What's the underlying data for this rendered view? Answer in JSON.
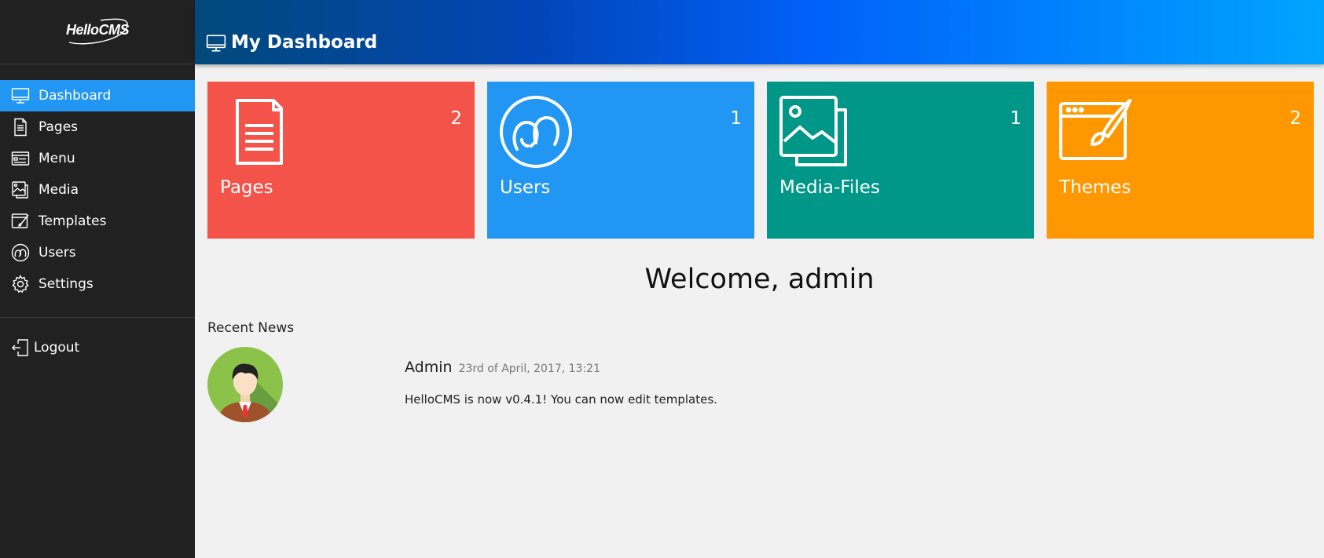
{
  "sidebar": {
    "logo": "HelloCMS",
    "items": [
      {
        "label": "Dashboard",
        "icon": "monitor-icon",
        "active": true
      },
      {
        "label": "Pages",
        "icon": "page-icon"
      },
      {
        "label": "Menu",
        "icon": "menu-icon"
      },
      {
        "label": "Media",
        "icon": "media-icon"
      },
      {
        "label": "Templates",
        "icon": "template-icon"
      },
      {
        "label": "Users",
        "icon": "users-icon"
      },
      {
        "label": "Settings",
        "icon": "gear-icon"
      }
    ],
    "logout": "Logout"
  },
  "header": {
    "title": "My Dashboard"
  },
  "tiles": [
    {
      "label": "Pages",
      "count": "2",
      "color": "#f4534a",
      "icon": "page-icon"
    },
    {
      "label": "Users",
      "count": "1",
      "color": "#2196f3",
      "icon": "users-icon"
    },
    {
      "label": "Media-Files",
      "count": "1",
      "color": "#009688",
      "icon": "media-icon"
    },
    {
      "label": "Themes",
      "count": "2",
      "color": "#ff9800",
      "icon": "theme-icon"
    }
  ],
  "welcome": "Welcome, admin",
  "news": {
    "heading": "Recent News",
    "author": "Admin",
    "date": "23rd of April, 2017, 13:21",
    "text": "HelloCMS is now v0.4.1! You can now edit templates."
  },
  "colors": {
    "sidebar_bg": "#212121",
    "active": "#2196f3",
    "background": "#f1f1f1"
  }
}
